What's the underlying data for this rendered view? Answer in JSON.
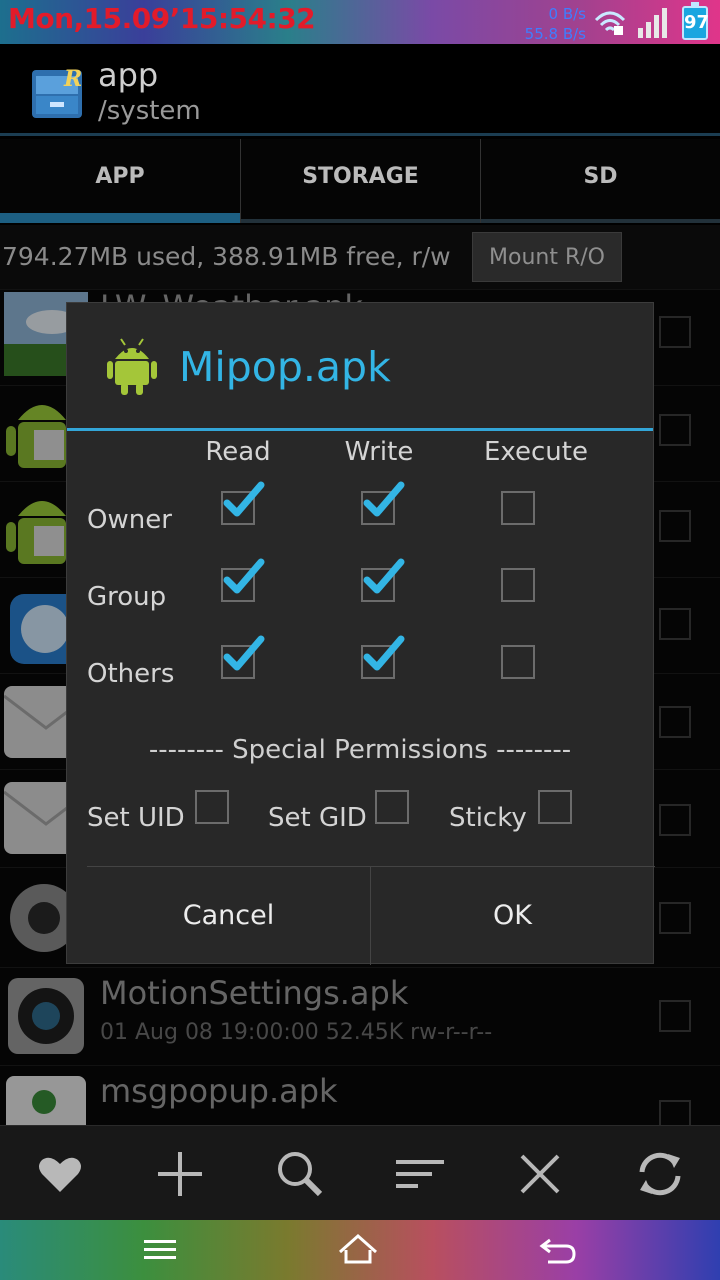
{
  "status": {
    "clock": "Mon,15.09’15:54:32",
    "speed_up": "0 B/s",
    "speed_down": "55.8 B/s",
    "battery": "97"
  },
  "actionbar": {
    "title": "app",
    "subtitle": "/system"
  },
  "tabs": [
    {
      "label": "APP"
    },
    {
      "label": "STORAGE"
    },
    {
      "label": "SD"
    }
  ],
  "info": {
    "text": "794.27MB used, 388.91MB free, r/w",
    "mount_label": "Mount R/O"
  },
  "files": {
    "partial_top": "LW_Weather.apk",
    "motion": {
      "name": "MotionSettings.apk",
      "meta": "01 Aug 08 19:00:00  52.45K  rw-r--r--"
    },
    "msgpopup": {
      "name": "msgpopup.apk"
    }
  },
  "dialog": {
    "title": "Mipop.apk",
    "columns": [
      "Read",
      "Write",
      "Execute"
    ],
    "rows": [
      {
        "label": "Owner",
        "read": true,
        "write": true,
        "execute": false
      },
      {
        "label": "Group",
        "read": true,
        "write": true,
        "execute": false
      },
      {
        "label": "Others",
        "read": true,
        "write": true,
        "execute": false
      }
    ],
    "special_header": "-------- Special Permissions --------",
    "special": [
      {
        "label": "Set UID",
        "checked": false
      },
      {
        "label": "Set GID",
        "checked": false
      },
      {
        "label": "Sticky",
        "checked": false
      }
    ],
    "cancel": "Cancel",
    "ok": "OK"
  },
  "toolbar": [
    "heart-icon",
    "plus-icon",
    "search-icon",
    "sort-icon",
    "close-icon",
    "refresh-icon"
  ],
  "navbar": [
    "menu-icon",
    "home-icon",
    "back-icon"
  ],
  "colors": {
    "accent": "#33b5e5",
    "clock": "#e21b2a"
  }
}
